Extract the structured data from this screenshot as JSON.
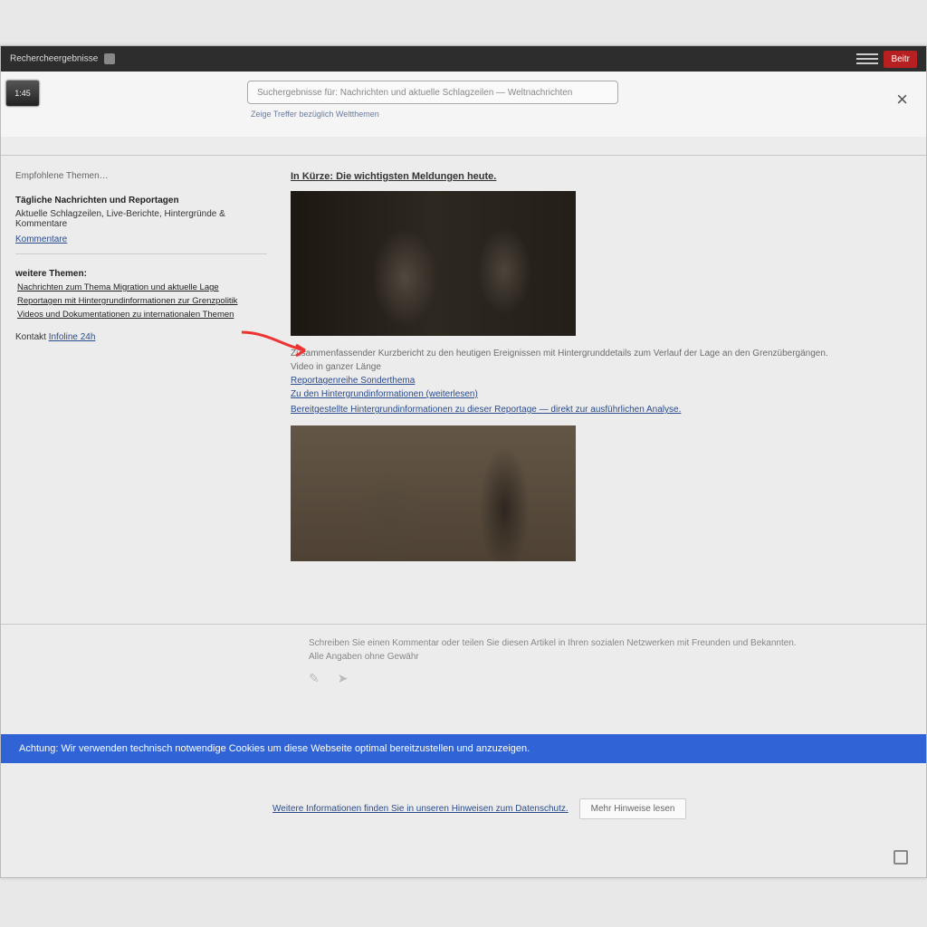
{
  "topbar": {
    "title": "Rechercheergebnisse",
    "button_label": "Beitr"
  },
  "subheader": {
    "logo_text": "1:45",
    "search_placeholder": "Suchergebnisse für: Nachrichten und aktuelle Schlagzeilen — Weltnachrichten",
    "sub_text": "Zeige Treffer bezüglich Weltthemen"
  },
  "sidebar": {
    "heading": "Empfohlene Themen…",
    "section1": {
      "bold": "Tägliche Nachrichten und Reportagen",
      "line": "Aktuelle Schlagzeilen, Live-Berichte, Hintergründe & Kommentare",
      "link": "Kommentare"
    },
    "section2": {
      "bold": "weitere Themen:",
      "items": [
        "Nachrichten zum Thema Migration und aktuelle Lage",
        "Reportagen mit Hintergrundinformationen zur Grenzpolitik",
        "Videos und Dokumentationen zu internationalen Themen"
      ]
    },
    "contact": {
      "label": "Kontakt",
      "link": "Infoline 24h"
    }
  },
  "main": {
    "article_title": "In Kürze: Die wichtigsten Meldungen heute.",
    "paragraph": "Zusammenfassender Kurzbericht zu den heutigen Ereignissen mit Hintergrunddetails zum Verlauf der Lage an den Grenzübergängen.",
    "l1": "Video in ganzer Länge",
    "l2": "Reportagenreihe Sonderthema",
    "l3": "Zu den Hintergrundinformationen (weiterlesen)",
    "l4": "Bereitgestellte Hintergrundinformationen zu dieser Reportage — direkt zur ausführlichen Analyse."
  },
  "footer": {
    "line1": "Schreiben Sie einen Kommentar oder teilen Sie diesen Artikel in Ihren sozialen Netzwerken mit Freunden und Bekannten.",
    "line2": "Alle Angaben ohne Gewähr"
  },
  "bluebar": {
    "text": "Achtung: Wir verwenden technisch notwendige Cookies um diese Webseite optimal bereitzustellen und anzuzeigen."
  },
  "bottom": {
    "link": "Weitere Informationen finden Sie in unseren Hinweisen zum Datenschutz.",
    "button": "Mehr Hinweise lesen"
  }
}
